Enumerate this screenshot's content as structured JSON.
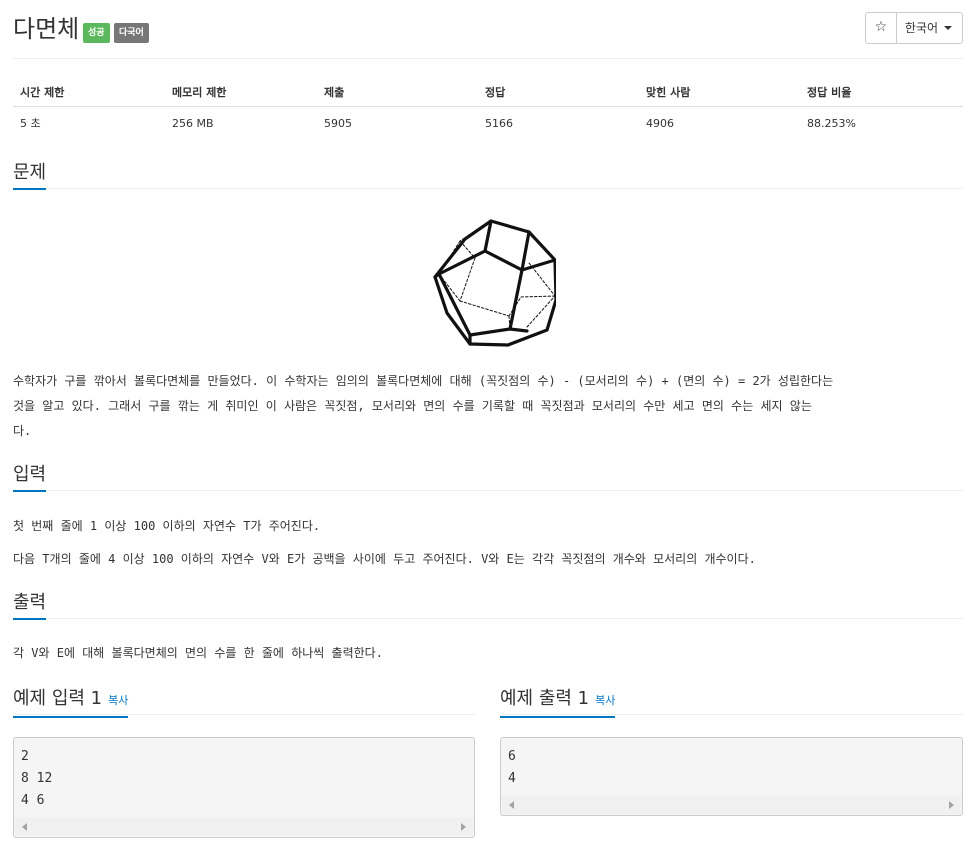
{
  "header": {
    "title": "다면체",
    "badges": [
      "성공",
      "다국어"
    ],
    "star_icon": "star-outline-icon",
    "language": "한국어"
  },
  "info_table": {
    "headers": [
      "시간 제한",
      "메모리 제한",
      "제출",
      "정답",
      "맞힌 사람",
      "정답 비율"
    ],
    "values": [
      "5 초",
      "256 MB",
      "5905",
      "5166",
      "4906",
      "88.253%"
    ]
  },
  "problem": {
    "heading": "문제",
    "image": "dodecahedron-figure",
    "lines": [
      "수학자가 구를 깎아서 볼록다면체를 만들었다. 이 수학자는 임의의 볼록다면체에 대해 (꼭짓점의 수) - (모서리의 수) + (면의 수) = 2가 성립한다는",
      "것을 알고 있다. 그래서 구를 깎는 게 취미인 이 사람은 꼭짓점, 모서리와 면의 수를 기록할 때 꼭짓점과 모서리의 수만 세고 면의 수는 세지 않는",
      "다."
    ]
  },
  "input": {
    "heading": "입력",
    "lines": [
      "첫 번째 줄에 1 이상 100 이하의 자연수 T가 주어진다.",
      "다음 T개의 줄에 4 이상 100 이하의 자연수 V와 E가 공백을 사이에 두고 주어진다. V와 E는 각각 꼭짓점의 개수와 모서리의 개수이다."
    ]
  },
  "output": {
    "heading": "출력",
    "lines": [
      "각 V와 E에 대해 볼록다면체의 면의 수를 한 줄에 하나씩 출력한다."
    ]
  },
  "samples": {
    "input": {
      "title": "예제 입력 1",
      "copy": "복사",
      "text": "2\n8 12\n4 6"
    },
    "output": {
      "title": "예제 출력 1",
      "copy": "복사",
      "text": "6\n4"
    }
  }
}
